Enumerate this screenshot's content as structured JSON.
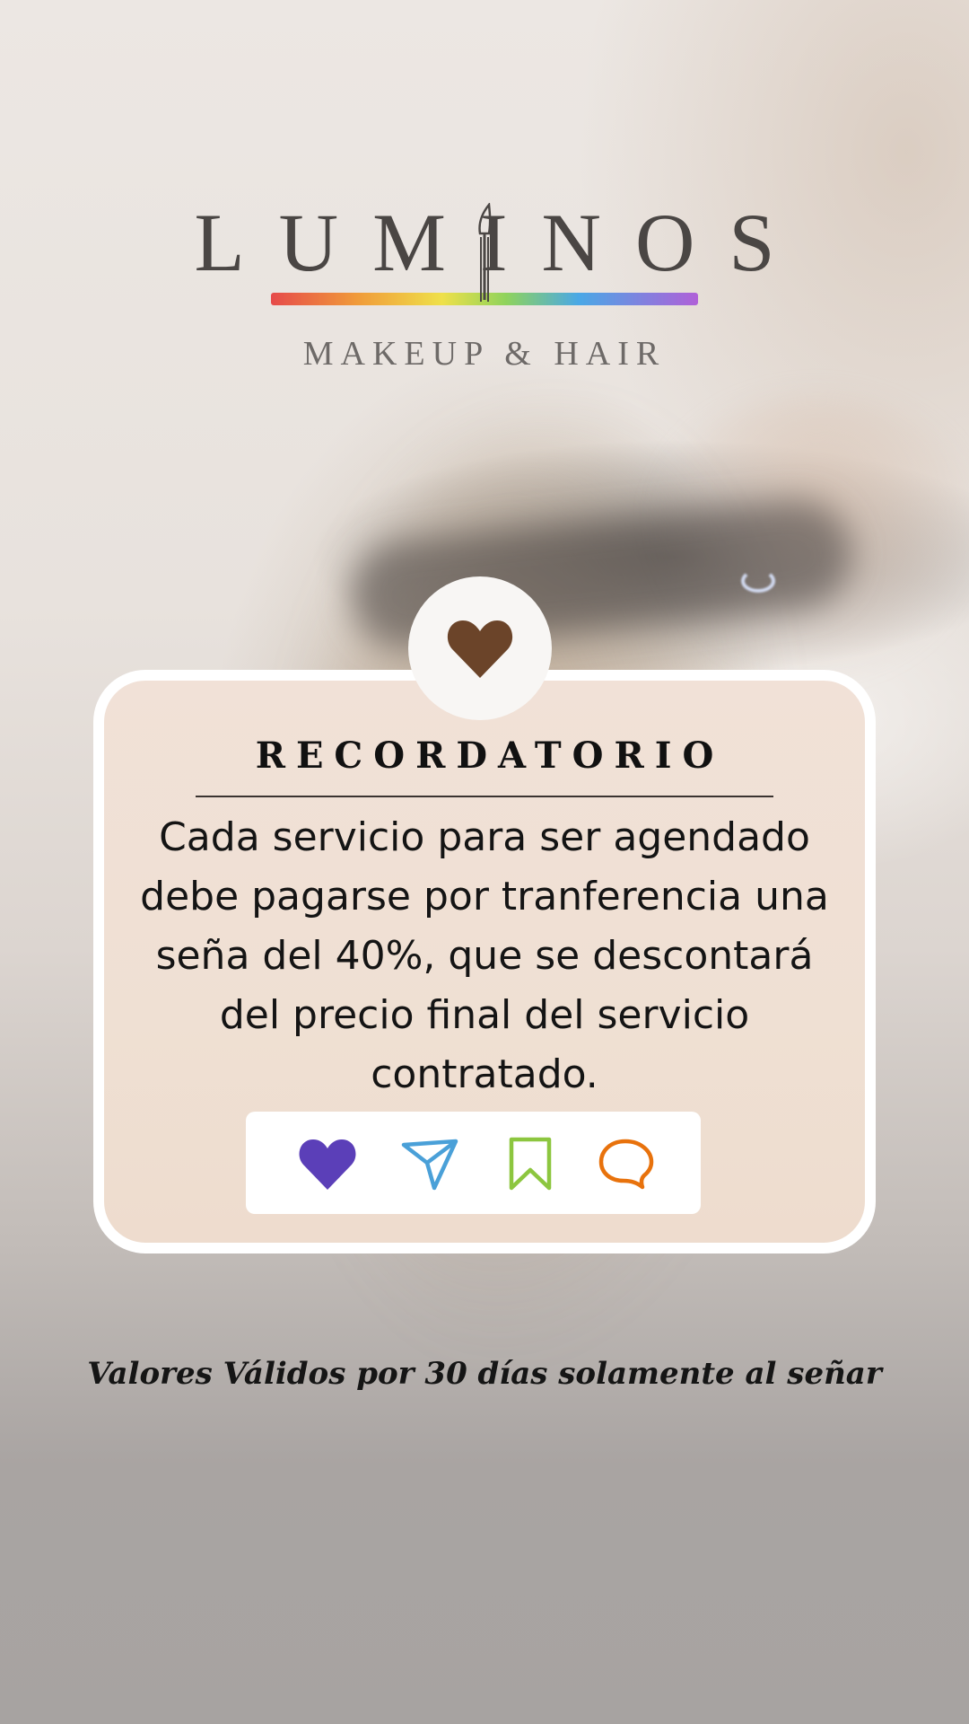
{
  "brand": {
    "name": "LUMINOS",
    "tagline": "MAKEUP & HAIR"
  },
  "card": {
    "title": "RECORDATORIO",
    "body": "Cada servicio para ser agendado debe pagarse por tranferencia una seña del 40%, que se descontará del precio final del servicio contratado.",
    "badge_icon": "heart-icon",
    "actions": [
      {
        "icon": "heart-icon",
        "color": "#5b3fb8"
      },
      {
        "icon": "send-icon",
        "color": "#4aa0d8"
      },
      {
        "icon": "bookmark-icon",
        "color": "#8cc63f"
      },
      {
        "icon": "comment-icon",
        "color": "#e8720c"
      }
    ]
  },
  "footer": {
    "note": "Valores Válidos por 30 días solamente al señar"
  },
  "colors": {
    "badge_heart": "#6b4429",
    "card_bg": "#f0e0d4",
    "card_border": "#ffffff"
  }
}
